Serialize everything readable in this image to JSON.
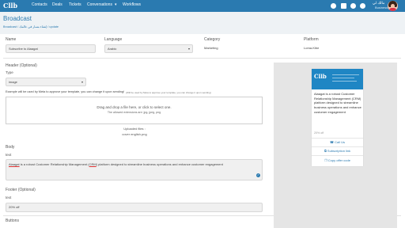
{
  "nav": {
    "logo": "Cllb",
    "links": [
      "Contacts",
      "Deals",
      "Tickets",
      "Conversations",
      "Workflows"
    ],
    "caret": "▾",
    "icons": [
      "chat-icon",
      "settings-icon",
      "help-icon",
      "notifications-icon"
    ],
    "user_name": "مالك لي",
    "user_role": "Business",
    "brand_color": "#2a7ab0"
  },
  "header": {
    "title": "Broadcast",
    "breadcrumb": "Broadcast / إنشاء مسار في عالمك / update"
  },
  "meta": {
    "name_label": "Name",
    "name_value": "Subscribe to Alaagat",
    "language_label": "Language",
    "language_value": "Arabic",
    "category_label": "Category",
    "category_value": "Marketing",
    "platform_label": "Platform",
    "platform_value": "Loma-Kibe"
  },
  "header_section": {
    "label": "Header (Optional)",
    "type_label": "Type",
    "type_value": "image",
    "help_text": "Example will be used by Meta to approve your template, you can change it upon sending!",
    "help_text_small": "(Will be used by Meta to approve your template, you can change it upon sending)",
    "dropzone_text": "Drag and drop a file here, or click to select one.",
    "dropzone_sub": "The allowed extensions are: jpg, jpeg, png",
    "uploaded_label": "Uploaded files :",
    "uploaded_file": "cover english.png"
  },
  "body_section": {
    "label": "Body",
    "sub_label": "text",
    "link_word": "Alaagat",
    "text_part1": " is a robust Customer Relationship Management (",
    "crm_word": "CRM",
    "text_part2": ") platform designed to streamline business operations and enhance customer engagement"
  },
  "footer_section": {
    "label": "Footer (Optional)",
    "sub_label": "text",
    "value": "20% off"
  },
  "buttons_section": {
    "label": "Buttons"
  },
  "preview": {
    "logo": "Cllb",
    "text": "Alaagat is a robust Customer Relationship Management (CRM) platform designed to streamline business operations and enhance customer engagement",
    "footer": "20% off",
    "call_button": "Call Us",
    "subscription_button": "Subscription link",
    "copy_button": "Copy offer code"
  }
}
